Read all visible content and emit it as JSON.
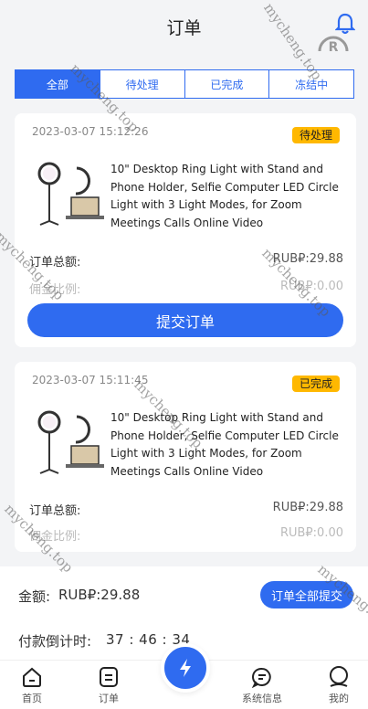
{
  "header": {
    "title": "订单"
  },
  "tabs": [
    {
      "label": "全部",
      "active": true
    },
    {
      "label": "待处理",
      "active": false
    },
    {
      "label": "已完成",
      "active": false
    },
    {
      "label": "冻结中",
      "active": false
    }
  ],
  "orders": [
    {
      "time": "2023-03-07 15:12:26",
      "status": "待处理",
      "title": "10\" Desktop Ring Light with Stand and Phone Holder, Selfie Computer LED Circle Light with 3 Light Modes, for Zoom Meetings Calls Online Video",
      "total_label": "订单总额:",
      "total_value": "RUB₽:29.88",
      "commission_label": "佣金比例:",
      "commission_value": "RUB₽:0.00",
      "submit_label": "提交订单"
    },
    {
      "time": "2023-03-07 15:11:45",
      "status": "已完成",
      "title": "10\" Desktop Ring Light with Stand and Phone Holder, Selfie Computer LED Circle Light with 3 Light Modes, for Zoom Meetings Calls Online Video",
      "total_label": "订单总额:",
      "total_value": "RUB₽:29.88",
      "commission_label": "佣金比例:",
      "commission_value": "RUB₽:0.00"
    }
  ],
  "summary": {
    "amount_label": "金额:",
    "amount_value": "RUB₽:29.88",
    "submit_all_label": "订单全部提交",
    "countdown_label": "付款倒计时:",
    "countdown_value": "37 : 46 : 34"
  },
  "tabbar": {
    "home": "首页",
    "orders": "订单",
    "messages": "系统信息",
    "mine": "我的"
  },
  "watermark": "mycheng.top",
  "colors": {
    "primary": "#2f6bf0",
    "badge": "#ffb800"
  }
}
